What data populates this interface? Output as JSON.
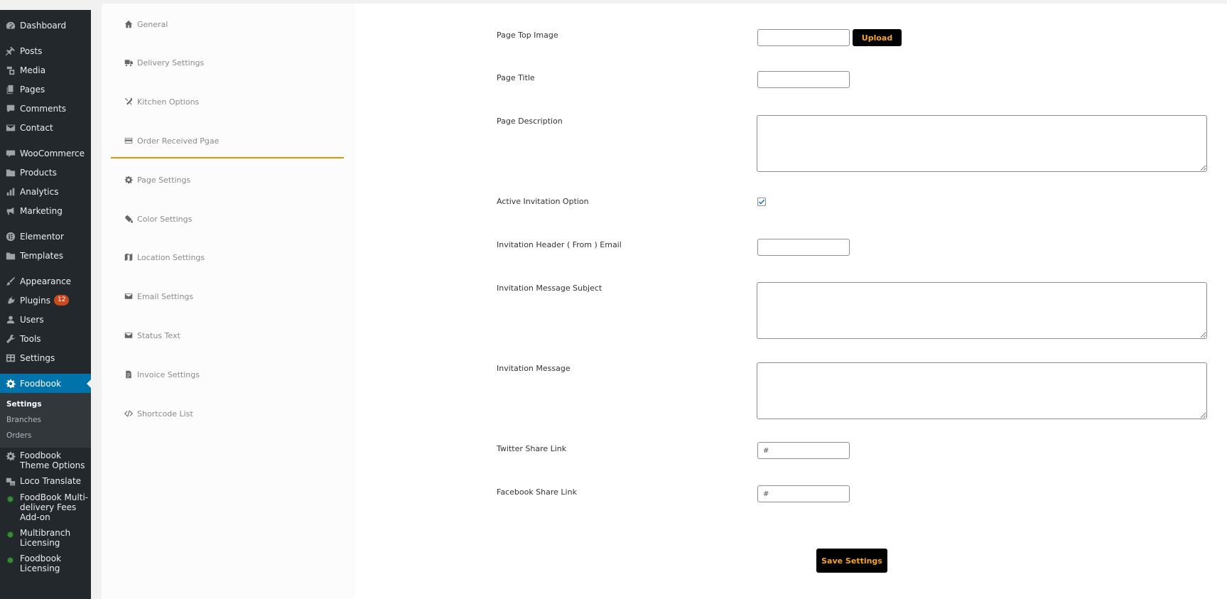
{
  "sidebar": {
    "items": [
      {
        "label": "Dashboard",
        "icon": "dashboard-icon"
      },
      {
        "label": "Posts",
        "icon": "pin-icon"
      },
      {
        "label": "Media",
        "icon": "media-icon"
      },
      {
        "label": "Pages",
        "icon": "pages-icon"
      },
      {
        "label": "Comments",
        "icon": "comment-icon"
      },
      {
        "label": "Contact",
        "icon": "mail-icon"
      },
      {
        "label": "WooCommerce",
        "icon": "woo-icon"
      },
      {
        "label": "Products",
        "icon": "products-icon"
      },
      {
        "label": "Analytics",
        "icon": "bar-chart-icon"
      },
      {
        "label": "Marketing",
        "icon": "megaphone-icon"
      },
      {
        "label": "Elementor",
        "icon": "elementor-icon"
      },
      {
        "label": "Templates",
        "icon": "folder-icon"
      },
      {
        "label": "Appearance",
        "icon": "brush-icon"
      },
      {
        "label": "Plugins",
        "icon": "plugin-icon",
        "badge": "12"
      },
      {
        "label": "Users",
        "icon": "user-icon"
      },
      {
        "label": "Tools",
        "icon": "wrench-icon"
      },
      {
        "label": "Settings",
        "icon": "settings-icon"
      },
      {
        "label": "Foodbook",
        "icon": "gear-icon"
      },
      {
        "label": "Foodbook Theme Options",
        "icon": "gear-icon"
      },
      {
        "label": "Loco Translate",
        "icon": "translate-icon"
      },
      {
        "label": "FoodBook Multi-delivery Fees Add-on",
        "icon": "dot-icon"
      },
      {
        "label": "Multibranch Licensing",
        "icon": "dot-icon"
      },
      {
        "label": "Foodbook Licensing",
        "icon": "dot-icon"
      }
    ],
    "submenu": [
      "Settings",
      "Branches",
      "Orders"
    ]
  },
  "tabs": [
    {
      "label": "General",
      "icon": "home-icon"
    },
    {
      "label": "Delivery Settings",
      "icon": "truck-icon"
    },
    {
      "label": "Kitchen Options",
      "icon": "tools-icon"
    },
    {
      "label": "Order Received Pgae",
      "icon": "credit-card-icon"
    },
    {
      "label": "Page Settings",
      "icon": "gear-icon"
    },
    {
      "label": "Color Settings",
      "icon": "paint-bucket-icon"
    },
    {
      "label": "Location Settings",
      "icon": "map-icon"
    },
    {
      "label": "Email Settings",
      "icon": "envelope-icon"
    },
    {
      "label": "Status Text",
      "icon": "envelope-icon"
    },
    {
      "label": "Invoice Settings",
      "icon": "file-icon"
    },
    {
      "label": "Shortcode List",
      "icon": "code-icon"
    }
  ],
  "form": {
    "page_top_image": {
      "label": "Page Top Image",
      "value": "",
      "upload_label": "Upload"
    },
    "page_title": {
      "label": "Page Title",
      "value": ""
    },
    "page_description": {
      "label": "Page Description",
      "value": ""
    },
    "active_invitation": {
      "label": "Active Invitation Option",
      "checked": true
    },
    "invitation_header_email": {
      "label": "Invitation Header ( From ) Email",
      "value": ""
    },
    "invitation_subject": {
      "label": "Invitation Message Subject",
      "value": ""
    },
    "invitation_message": {
      "label": "Invitation Message",
      "value": ""
    },
    "twitter_link": {
      "label": "Twitter Share Link",
      "value": "#"
    },
    "facebook_link": {
      "label": "Facebook Share Link",
      "value": "#"
    },
    "save_label": "Save Settings"
  },
  "colors": {
    "sidebar_bg": "#23282d",
    "active_blue": "#0073aa",
    "accent_orange": "#e6920a",
    "button_text": "#f5a623"
  }
}
